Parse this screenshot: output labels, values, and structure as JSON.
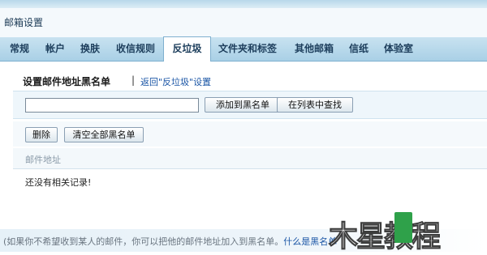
{
  "header": {
    "title": "邮箱设置"
  },
  "tabs": [
    {
      "label": "常规",
      "active": false
    },
    {
      "label": "帐户",
      "active": false
    },
    {
      "label": "换肤",
      "active": false
    },
    {
      "label": "收信规则",
      "active": false
    },
    {
      "label": "反垃圾",
      "active": true
    },
    {
      "label": "文件夹和标签",
      "active": false
    },
    {
      "label": "其他邮箱",
      "active": false
    },
    {
      "label": "信纸",
      "active": false
    },
    {
      "label": "体验室",
      "active": false
    }
  ],
  "section": {
    "title": "设置邮件地址黑名单",
    "separator": "|",
    "return_link": "返回\"反垃圾\"设置"
  },
  "toolbar": {
    "email_input_value": "",
    "add_button": "添加到黑名单",
    "find_button": "在列表中查找",
    "delete_button": "删除",
    "clear_button": "清空全部黑名单"
  },
  "list": {
    "column_header": "邮件地址",
    "empty_message": "还没有相关记录!"
  },
  "footer": {
    "text": "(如果你不希望收到某人的邮件，你可以把他的邮件地址加入到黑名单。",
    "link": "什么是黑名单"
  },
  "watermark": {
    "text": "木星教程"
  }
}
